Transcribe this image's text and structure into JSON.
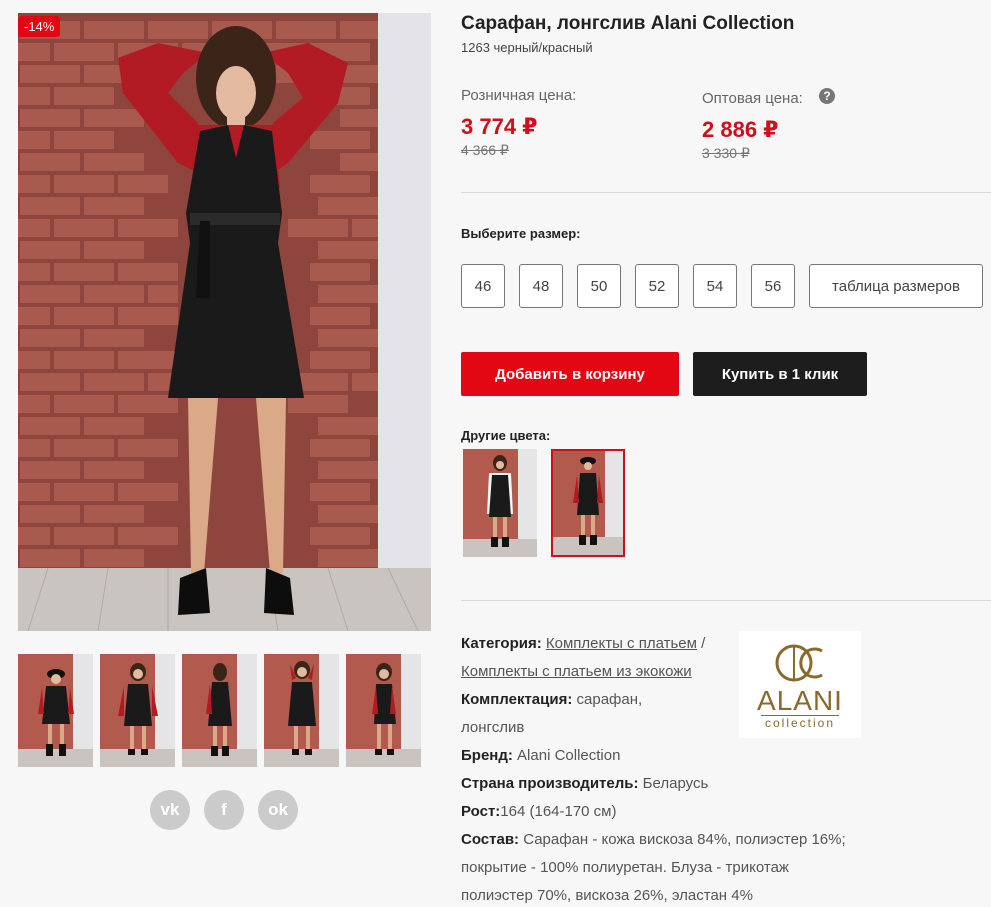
{
  "product": {
    "discount_badge": "-14%",
    "title": "Сарафан, лонгслив Alani Collection",
    "sku": "1263 черный/красный"
  },
  "prices": {
    "retail_label": "Розничная цена:",
    "retail_now": "3 774 ₽",
    "retail_old": "4 366 ₽",
    "wholesale_label": "Оптовая цена:",
    "wholesale_now": "2 886 ₽",
    "wholesale_old": "3 330 ₽",
    "help_icon": "?"
  },
  "size_select": {
    "title": "Выберите размер:",
    "sizes": [
      "46",
      "48",
      "50",
      "52",
      "54",
      "56"
    ],
    "table_label": "таблица размеров"
  },
  "actions": {
    "add_to_cart": "Добавить в корзину",
    "buy_one_click": "Купить в 1 клик"
  },
  "other_colors": {
    "title": "Другие цвета:"
  },
  "specs": {
    "category_label": "Категория:",
    "category_link1": "Комплекты с платьем",
    "category_sep": "/",
    "category_link2": "Комплекты с платьем из экокожи",
    "set_label": "Комплектация:",
    "set_value": "сарафан, лонгслив",
    "brand_label": "Бренд:",
    "brand_value": "Alani Collection",
    "country_label": "Страна производитель:",
    "country_value": "Беларусь",
    "height_label": "Рост:",
    "height_value": "164 (164-170 см)",
    "comp_label": "Состав:",
    "comp_value": "Сарафан - кожа вискоза 84%, полиэстер 16%; покрытие - 100% полиуретан. Блуза - трикотаж полиэстер 70%, вискоза 26%, эластан 4%"
  },
  "brand_logo": {
    "mark": "ac",
    "name": "ALANI",
    "sub": "collection"
  },
  "social": {
    "vk": "vk",
    "fb": "f",
    "ok": "ok"
  },
  "colors": {
    "accent": "#e30613",
    "dark_button": "#1d1d1d",
    "brand_gold": "#8a6a2c"
  }
}
